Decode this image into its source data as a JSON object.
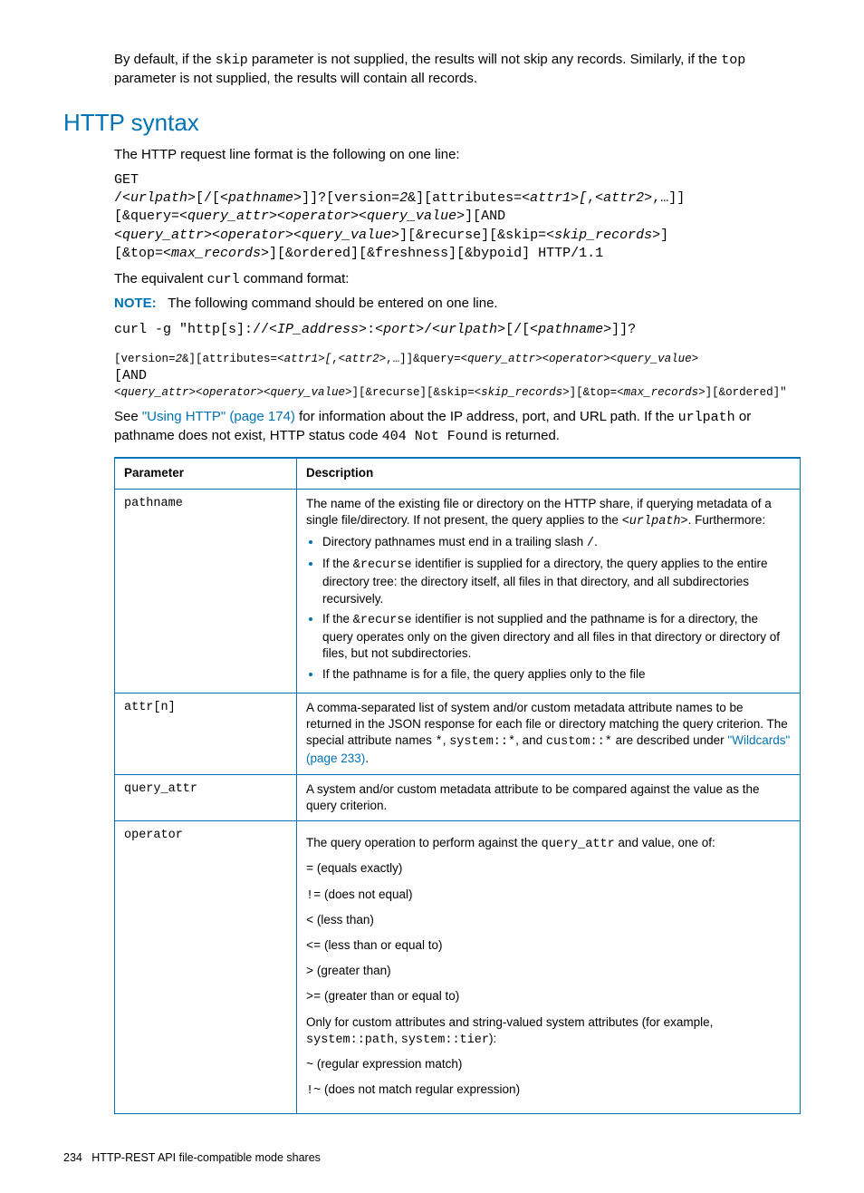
{
  "intro": {
    "p1_a": "By default, if the ",
    "p1_skip": "skip",
    "p1_b": " parameter is not supplied, the results will not skip any records. Similarly, if the ",
    "p1_top": "top",
    "p1_c": " parameter is not supplied, the results will contain all records."
  },
  "section_title": "HTTP syntax",
  "http": {
    "intro": "The HTTP request line format is the following on one line:",
    "get": "GET",
    "l1a": "/",
    "l1b": "<urlpath>",
    "l1c": "[/[",
    "l1d": "<pathname>",
    "l1e": "]]?[version=",
    "l1f": "2",
    "l1g": "&][attributes=",
    "l1h": "<attr1>[",
    "l1i": ",",
    "l1j": "<attr2>",
    "l1k": ",…]]",
    "l2a": "[&query=",
    "l2b": "<query_attr><operator><query_value>",
    "l2c": "][AND",
    "l3a": "<query_attr><operator><query_value>",
    "l3b": "][&recurse][&skip=",
    "l3c": "<skip_records>",
    "l3d": "]",
    "l4a": "[&top=",
    "l4b": "<max_records>",
    "l4c": "][&ordered][&freshness][&bypoid] HTTP/1.1",
    "equiv_a": "The equivalent ",
    "equiv_b": "curl",
    "equiv_c": " command format:",
    "note_label": "NOTE:",
    "note_text": "The following command should be entered on one line.",
    "curl_a": "curl -g \"http[s]://",
    "curl_b": "<IP_address>",
    "curl_c": ":",
    "curl_d": "<port>",
    "curl_e": "/",
    "curl_f": "<urlpath>",
    "curl_g": "[/[",
    "curl_h": "<pathname>",
    "curl_i": "]]?",
    "c2a": "[version=",
    "c2b": "2",
    "c2c": "&][attributes=",
    "c2d": "<attr1>[",
    "c2e": ",",
    "c2f": "<attr2>",
    "c2g": ",…]]&query=",
    "c2h": "<query_attr><operator><query_value>",
    "c3a": "[AND",
    "c4a": "<query_attr><operator><query_value>",
    "c4b": "][&recurse][&skip=",
    "c4c": "<skip_records>",
    "c4d": "][&top=",
    "c4e": "<max_records>",
    "c4f": "][&ordered]\"",
    "see_a": "See ",
    "see_link": "\"Using HTTP\" (page 174)",
    "see_b": " for information about the IP address, port, and URL path. If the ",
    "see_c": "urlpath",
    "see_d": " or pathname does not exist, HTTP status code ",
    "see_e": "404 Not Found",
    "see_f": " is returned."
  },
  "table": {
    "h1": "Parameter",
    "h2": "Description",
    "r1_param": "pathname",
    "r1_d1a": "The name of the existing file or directory on the HTTP share, if querying metadata of a single file/directory. If not present, the query applies to the ",
    "r1_d1b": "<urlpath>",
    "r1_d1c": ". Furthermore:",
    "r1_b1a": "Directory pathnames must end in a trailing slash ",
    "r1_b1b": "/",
    "r1_b1c": ".",
    "r1_b2a": "If the ",
    "r1_b2b": "&recurse",
    "r1_b2c": " identifier is supplied for a directory, the query applies to the entire directory tree: the directory itself, all files in that directory, and all subdirectories recursively.",
    "r1_b3a": "If the ",
    "r1_b3b": "&recurse",
    "r1_b3c": " identifier is not supplied and the pathname is for a directory, the query operates only on the given directory and all files in that directory or directory of files, but not subdirectories.",
    "r1_b4": "If the pathname is for a file, the query applies only to the file",
    "r2_param": "attr[n]",
    "r2_d_a": "A comma-separated list of system and/or custom metadata attribute names to be returned in the JSON response for each file or directory matching the query criterion. The special attribute names ",
    "r2_d_b": "*",
    "r2_d_c": ", ",
    "r2_d_d": "system::*",
    "r2_d_e": ", and ",
    "r2_d_f": "custom::*",
    "r2_d_g": " are described under ",
    "r2_link": "\"Wildcards\" (page 233)",
    "r2_d_h": ".",
    "r3_param": "query_attr",
    "r3_d": "A system and/or custom metadata attribute to be compared against the value as the query criterion.",
    "r4_param": "operator",
    "r4_d_a": "The query operation to perform against the ",
    "r4_d_b": "query_attr",
    "r4_d_c": " and value, one of:",
    "r4_op1a": "=",
    "r4_op1b": " (equals exactly)",
    "r4_op2a": "!=",
    "r4_op2b": " (does not equal)",
    "r4_op3a": "<",
    "r4_op3b": " (less than)",
    "r4_op4a": "<=",
    "r4_op4b": " (less than or equal to)",
    "r4_op5a": ">",
    "r4_op5b": " (greater than)",
    "r4_op6a": ">=",
    "r4_op6b": " (greater than or equal to)",
    "r4_mid_a": "Only for custom attributes and string-valued system attributes (for example, ",
    "r4_mid_b": "system::path",
    "r4_mid_c": ", ",
    "r4_mid_d": "system::tier",
    "r4_mid_e": "):",
    "r4_op7a": "~",
    "r4_op7b": " (regular expression match)",
    "r4_op8a": "!~",
    "r4_op8b": " (does not match regular expression)"
  },
  "footer": {
    "page": "234",
    "title": "HTTP-REST API file-compatible mode shares"
  }
}
